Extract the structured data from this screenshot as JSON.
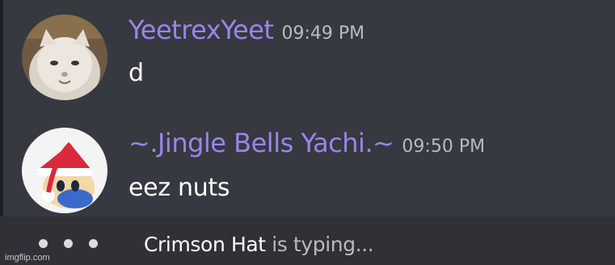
{
  "messages": [
    {
      "username": "YeetrexYeet",
      "timestamp": "09:49 PM",
      "content": "d",
      "avatar_icon": "cat-avatar-icon"
    },
    {
      "username": "~.Jingle Bells Yachi.~",
      "timestamp": "09:50 PM",
      "content": "eez nuts",
      "avatar_icon": "santa-hat-character-avatar-icon"
    }
  ],
  "typing": {
    "user": "Crimson Hat",
    "suffix": " is typing..."
  },
  "watermark": "imgflip.com",
  "colors": {
    "background": "#36393f",
    "username": "#9b84ec",
    "timestamp": "#b9bbbe",
    "message_text": "#ffffff",
    "typing_bar": "#2f3136"
  }
}
